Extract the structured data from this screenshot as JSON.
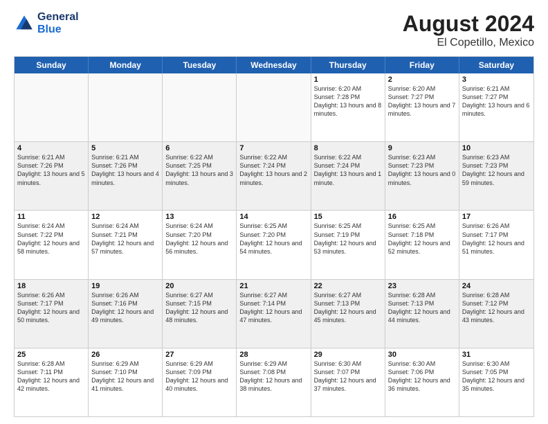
{
  "header": {
    "logo": {
      "line1": "General",
      "line2": "Blue"
    },
    "title": "August 2024",
    "subtitle": "El Copetillo, Mexico"
  },
  "calendar": {
    "days_of_week": [
      "Sunday",
      "Monday",
      "Tuesday",
      "Wednesday",
      "Thursday",
      "Friday",
      "Saturday"
    ],
    "weeks": [
      [
        {
          "day": "",
          "empty": true
        },
        {
          "day": "",
          "empty": true
        },
        {
          "day": "",
          "empty": true
        },
        {
          "day": "",
          "empty": true
        },
        {
          "day": "1",
          "sunrise": "6:20 AM",
          "sunset": "7:28 PM",
          "daylight": "13 hours and 8 minutes."
        },
        {
          "day": "2",
          "sunrise": "6:20 AM",
          "sunset": "7:27 PM",
          "daylight": "13 hours and 7 minutes."
        },
        {
          "day": "3",
          "sunrise": "6:21 AM",
          "sunset": "7:27 PM",
          "daylight": "13 hours and 6 minutes."
        }
      ],
      [
        {
          "day": "4",
          "sunrise": "6:21 AM",
          "sunset": "7:26 PM",
          "daylight": "13 hours and 5 minutes."
        },
        {
          "day": "5",
          "sunrise": "6:21 AM",
          "sunset": "7:26 PM",
          "daylight": "13 hours and 4 minutes."
        },
        {
          "day": "6",
          "sunrise": "6:22 AM",
          "sunset": "7:25 PM",
          "daylight": "13 hours and 3 minutes."
        },
        {
          "day": "7",
          "sunrise": "6:22 AM",
          "sunset": "7:24 PM",
          "daylight": "13 hours and 2 minutes."
        },
        {
          "day": "8",
          "sunrise": "6:22 AM",
          "sunset": "7:24 PM",
          "daylight": "13 hours and 1 minute."
        },
        {
          "day": "9",
          "sunrise": "6:23 AM",
          "sunset": "7:23 PM",
          "daylight": "13 hours and 0 minutes."
        },
        {
          "day": "10",
          "sunrise": "6:23 AM",
          "sunset": "7:23 PM",
          "daylight": "12 hours and 59 minutes."
        }
      ],
      [
        {
          "day": "11",
          "sunrise": "6:24 AM",
          "sunset": "7:22 PM",
          "daylight": "12 hours and 58 minutes."
        },
        {
          "day": "12",
          "sunrise": "6:24 AM",
          "sunset": "7:21 PM",
          "daylight": "12 hours and 57 minutes."
        },
        {
          "day": "13",
          "sunrise": "6:24 AM",
          "sunset": "7:20 PM",
          "daylight": "12 hours and 56 minutes."
        },
        {
          "day": "14",
          "sunrise": "6:25 AM",
          "sunset": "7:20 PM",
          "daylight": "12 hours and 54 minutes."
        },
        {
          "day": "15",
          "sunrise": "6:25 AM",
          "sunset": "7:19 PM",
          "daylight": "12 hours and 53 minutes."
        },
        {
          "day": "16",
          "sunrise": "6:25 AM",
          "sunset": "7:18 PM",
          "daylight": "12 hours and 52 minutes."
        },
        {
          "day": "17",
          "sunrise": "6:26 AM",
          "sunset": "7:17 PM",
          "daylight": "12 hours and 51 minutes."
        }
      ],
      [
        {
          "day": "18",
          "sunrise": "6:26 AM",
          "sunset": "7:17 PM",
          "daylight": "12 hours and 50 minutes."
        },
        {
          "day": "19",
          "sunrise": "6:26 AM",
          "sunset": "7:16 PM",
          "daylight": "12 hours and 49 minutes."
        },
        {
          "day": "20",
          "sunrise": "6:27 AM",
          "sunset": "7:15 PM",
          "daylight": "12 hours and 48 minutes."
        },
        {
          "day": "21",
          "sunrise": "6:27 AM",
          "sunset": "7:14 PM",
          "daylight": "12 hours and 47 minutes."
        },
        {
          "day": "22",
          "sunrise": "6:27 AM",
          "sunset": "7:13 PM",
          "daylight": "12 hours and 45 minutes."
        },
        {
          "day": "23",
          "sunrise": "6:28 AM",
          "sunset": "7:13 PM",
          "daylight": "12 hours and 44 minutes."
        },
        {
          "day": "24",
          "sunrise": "6:28 AM",
          "sunset": "7:12 PM",
          "daylight": "12 hours and 43 minutes."
        }
      ],
      [
        {
          "day": "25",
          "sunrise": "6:28 AM",
          "sunset": "7:11 PM",
          "daylight": "12 hours and 42 minutes."
        },
        {
          "day": "26",
          "sunrise": "6:29 AM",
          "sunset": "7:10 PM",
          "daylight": "12 hours and 41 minutes."
        },
        {
          "day": "27",
          "sunrise": "6:29 AM",
          "sunset": "7:09 PM",
          "daylight": "12 hours and 40 minutes."
        },
        {
          "day": "28",
          "sunrise": "6:29 AM",
          "sunset": "7:08 PM",
          "daylight": "12 hours and 38 minutes."
        },
        {
          "day": "29",
          "sunrise": "6:30 AM",
          "sunset": "7:07 PM",
          "daylight": "12 hours and 37 minutes."
        },
        {
          "day": "30",
          "sunrise": "6:30 AM",
          "sunset": "7:06 PM",
          "daylight": "12 hours and 36 minutes."
        },
        {
          "day": "31",
          "sunrise": "6:30 AM",
          "sunset": "7:05 PM",
          "daylight": "12 hours and 35 minutes."
        }
      ]
    ]
  }
}
